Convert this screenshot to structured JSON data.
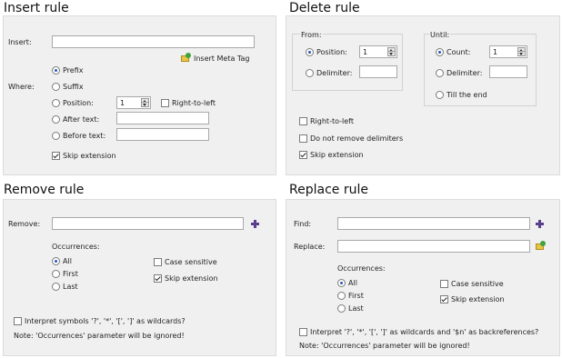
{
  "insert": {
    "title": "Insert rule",
    "insert_label": "Insert:",
    "insert_value": "",
    "meta_tag_label": "Insert Meta Tag",
    "where_label": "Where:",
    "opt_prefix": "Prefix",
    "opt_suffix": "Suffix",
    "opt_position": "Position:",
    "position_value": "1",
    "right_to_left": "Right-to-left",
    "opt_after": "After text:",
    "opt_before": "Before text:",
    "after_value": "",
    "before_value": "",
    "skip_extension": "Skip extension"
  },
  "delete": {
    "title": "Delete rule",
    "from_label": "From:",
    "from_position": "Position:",
    "from_position_value": "1",
    "from_delimiter": "Delimiter:",
    "until_label": "Until:",
    "until_count": "Count:",
    "until_count_value": "1",
    "until_delimiter": "Delimiter:",
    "till_end": "Till the end",
    "right_to_left": "Right-to-left",
    "no_remove_delims": "Do not remove delimiters",
    "skip_extension": "Skip extension"
  },
  "remove": {
    "title": "Remove rule",
    "remove_label": "Remove:",
    "remove_value": "",
    "occurrences_label": "Occurrences:",
    "opt_all": "All",
    "opt_first": "First",
    "opt_last": "Last",
    "case_sensitive": "Case sensitive",
    "skip_extension": "Skip extension",
    "wildcards": "Interpret symbols '?', '*', '[', ']' as wildcards?",
    "note": "Note: 'Occurrences' parameter will be ignored!"
  },
  "replace": {
    "title": "Replace rule",
    "find_label": "Find:",
    "find_value": "",
    "replace_label": "Replace:",
    "replace_value": "",
    "occurrences_label": "Occurrences:",
    "opt_all": "All",
    "opt_first": "First",
    "opt_last": "Last",
    "case_sensitive": "Case sensitive",
    "skip_extension": "Skip extension",
    "wildcards": "Interpret '?', '*', '[', ']' as wildcards and '$n' as backreferences?",
    "note": "Note: 'Occurrences' parameter will be ignored!"
  }
}
